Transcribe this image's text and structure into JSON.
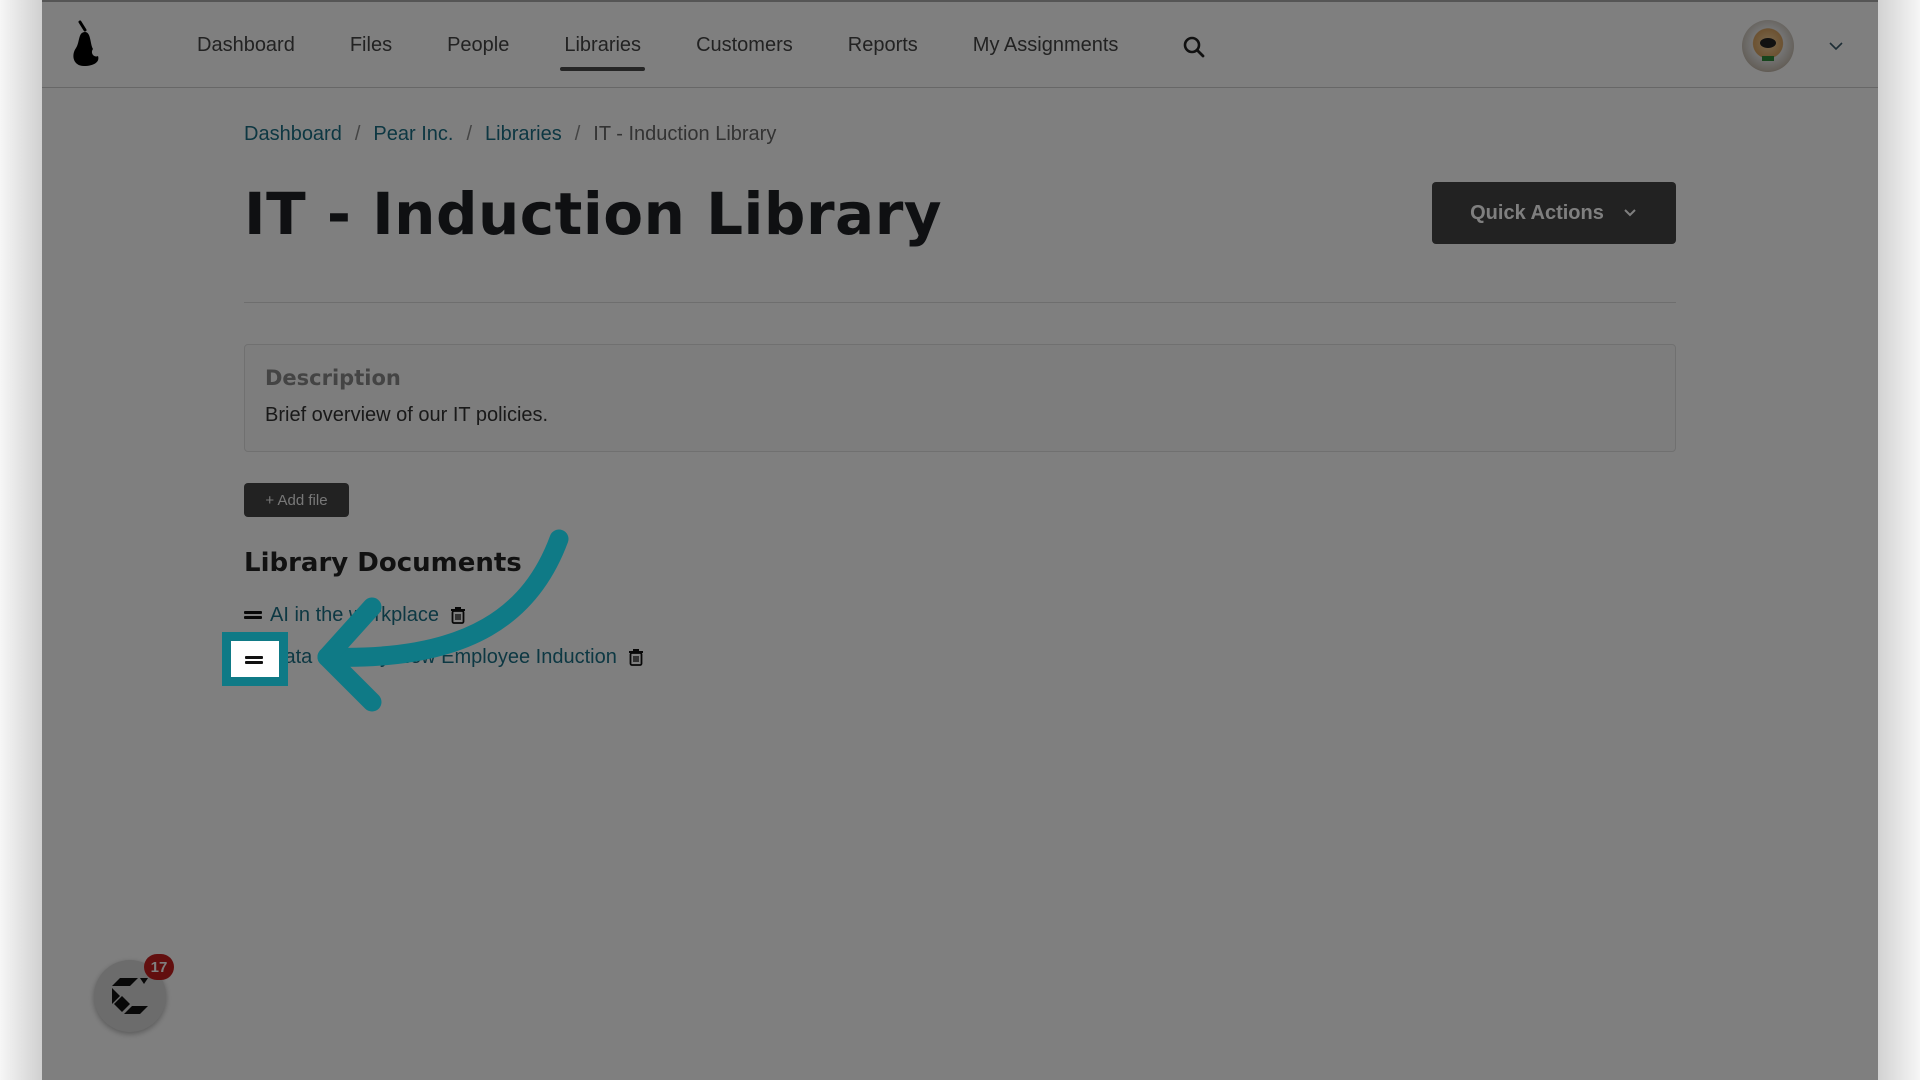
{
  "nav": {
    "items": [
      {
        "label": "Dashboard",
        "active": false
      },
      {
        "label": "Files",
        "active": false
      },
      {
        "label": "People",
        "active": false
      },
      {
        "label": "Libraries",
        "active": true
      },
      {
        "label": "Customers",
        "active": false
      },
      {
        "label": "Reports",
        "active": false
      },
      {
        "label": "My Assignments",
        "active": false
      }
    ],
    "search_icon": "search-icon",
    "logo_icon": "pear-logo-icon",
    "avatar_icon": "user-avatar",
    "avatar_menu_icon": "chevron-down-icon"
  },
  "breadcrumb": [
    {
      "label": "Dashboard",
      "link": true
    },
    {
      "label": "Pear Inc.",
      "link": true
    },
    {
      "label": "Libraries",
      "link": true
    },
    {
      "label": "IT - Induction Library",
      "link": false
    }
  ],
  "breadcrumb_separator": "/",
  "page": {
    "title": "IT - Induction Library",
    "quick_actions_label": "Quick Actions"
  },
  "description": {
    "label": "Description",
    "text": "Brief overview of our IT policies."
  },
  "add_file_label": "+ Add file",
  "library_documents": {
    "heading": "Library Documents",
    "items": [
      {
        "title": "AI in the workplace"
      },
      {
        "title": "Data Security New Employee Induction"
      }
    ]
  },
  "widget": {
    "badge_count": "17"
  },
  "colors": {
    "accent": "#0f7a86",
    "link": "#1b7086",
    "badge": "#c41f1f",
    "button_dark": "#444444"
  }
}
